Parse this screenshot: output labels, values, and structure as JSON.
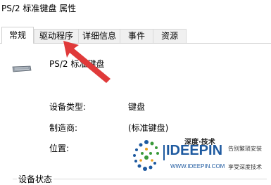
{
  "window": {
    "title": "PS/2 标准键盘 属性"
  },
  "tabs": [
    {
      "label": "常规",
      "active": true
    },
    {
      "label": "驱动程序",
      "active": false
    },
    {
      "label": "详细信息",
      "active": false
    },
    {
      "label": "事件",
      "active": false
    },
    {
      "label": "资源",
      "active": false
    }
  ],
  "device": {
    "icon": "keyboard-icon",
    "name": "PS/2 标准键盘"
  },
  "properties": [
    {
      "label": "设备类型:",
      "value": "键盘"
    },
    {
      "label": "制造商:",
      "value": "(标准键盘)"
    },
    {
      "label": "位置:",
      "value": ""
    }
  ],
  "status_section": {
    "title": "设备状态"
  },
  "annotation": {
    "icon": "red-arrow-pointer",
    "color": "#e03a3a"
  },
  "watermark": {
    "logo": "deepin-dots-logo",
    "cn_title": "深度·技术",
    "brand": "IDEEPIN",
    "tagline1": "告别繁琐安装",
    "url": "WWW.IDEEPIN.COM",
    "tagline2": "享受深度技术"
  }
}
